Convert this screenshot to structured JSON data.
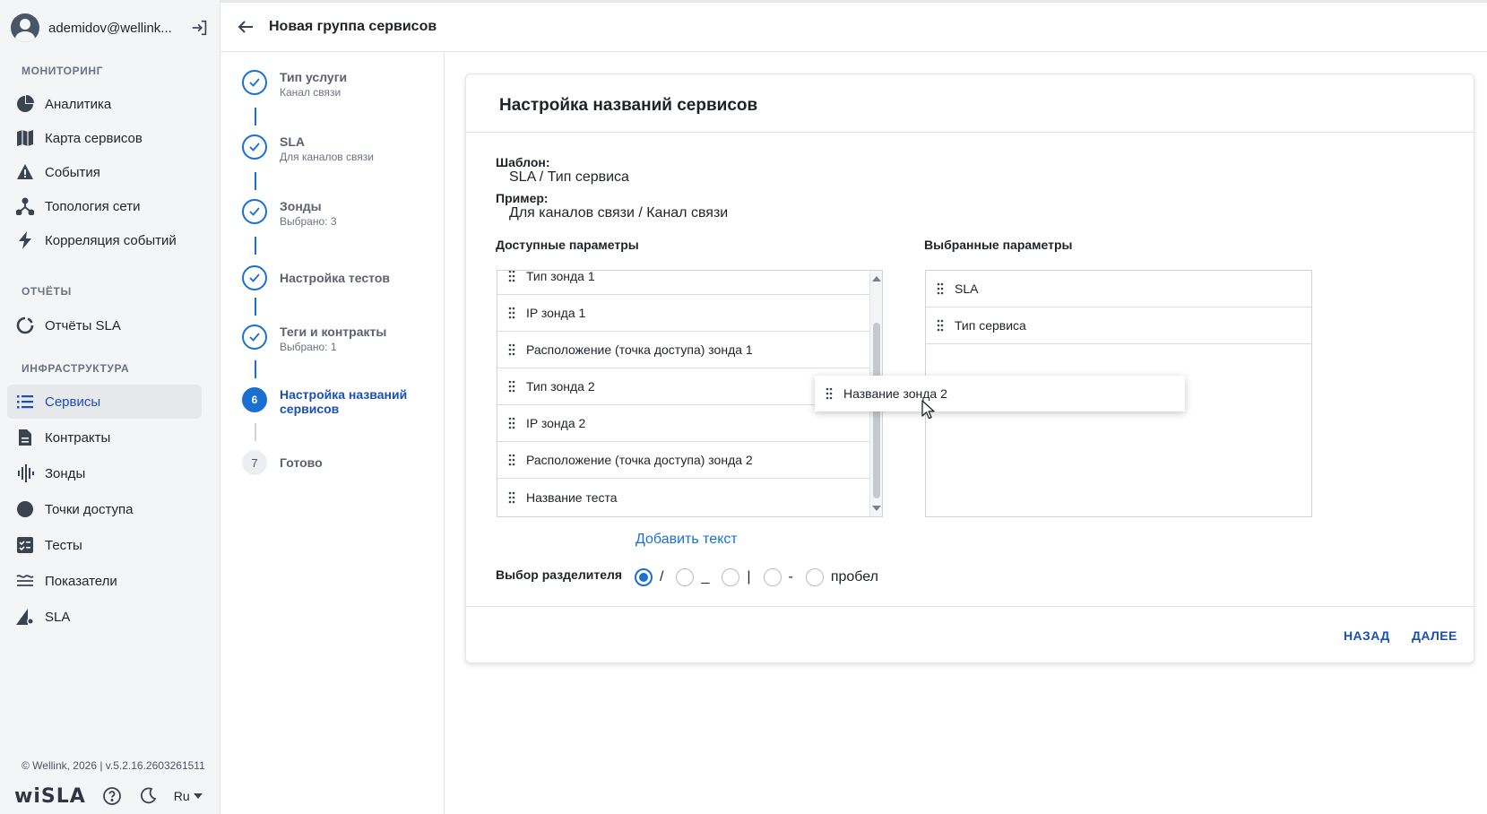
{
  "user": {
    "name": "ademidov@wellink..."
  },
  "sidebar": {
    "sections": {
      "monitoring": "МОНИТОРИНГ",
      "reports": "ОТЧЁТЫ",
      "infrastructure": "ИНФРАСТРУКТУРА"
    },
    "items": {
      "analytics": "Аналитика",
      "service_map": "Карта сервисов",
      "events": "События",
      "topology": "Топология сети",
      "correlation": "Корреляция событий",
      "sla_reports": "Отчёты SLA",
      "services": "Сервисы",
      "contracts": "Контракты",
      "probes": "Зонды",
      "access_points": "Точки доступа",
      "tests": "Тесты",
      "indicators": "Показатели",
      "sla": "SLA"
    },
    "active_item": "services",
    "footer_copy": "© Wellink, 2026 | v.5.2.16.2603261511",
    "brand": "wiSLA",
    "language": "Ru"
  },
  "header": {
    "title": "Новая группа сервисов"
  },
  "stepper": {
    "steps": [
      {
        "title": "Тип услуги",
        "subtitle": "Канал связи",
        "state": "done"
      },
      {
        "title": "SLA",
        "subtitle": "Для каналов связи",
        "state": "done"
      },
      {
        "title": "Зонды",
        "subtitle": "Выбрано: 3",
        "state": "done"
      },
      {
        "title": "Настройка тестов",
        "subtitle": "",
        "state": "done"
      },
      {
        "title": "Теги и контракты",
        "subtitle": "Выбрано: 1",
        "state": "done"
      },
      {
        "number": "6",
        "title": "Настройка названий сервисов",
        "subtitle": "",
        "state": "current"
      },
      {
        "number": "7",
        "title": "Готово",
        "subtitle": "",
        "state": "pending"
      }
    ]
  },
  "card": {
    "title": "Настройка названий сервисов",
    "template_label": "Шаблон:",
    "template_value": "SLA / Тип сервиса",
    "example_label": "Пример:",
    "example_value": "Для каналов связи / Канал связи",
    "available_title": "Доступные параметры",
    "selected_title": "Выбранные параметры",
    "available_params": [
      "Тип зонда 1",
      "IP зонда 1",
      "Расположение (точка доступа) зонда 1",
      "Тип зонда 2",
      "IP зонда 2",
      "Расположение (точка доступа) зонда 2",
      "Название теста"
    ],
    "selected_params": [
      "SLA",
      "Тип сервиса"
    ],
    "dragging_item": "Название зонда 2",
    "add_text": "Добавить текст",
    "separator_label": "Выбор разделителя",
    "separators": [
      "/",
      "_",
      "|",
      "-",
      "пробел"
    ],
    "selected_separator": "/",
    "back_button": "НАЗАД",
    "next_button": "ДАЛЕЕ"
  },
  "colors": {
    "accent": "#1b6fd1",
    "active_text": "#1b4fb4"
  }
}
